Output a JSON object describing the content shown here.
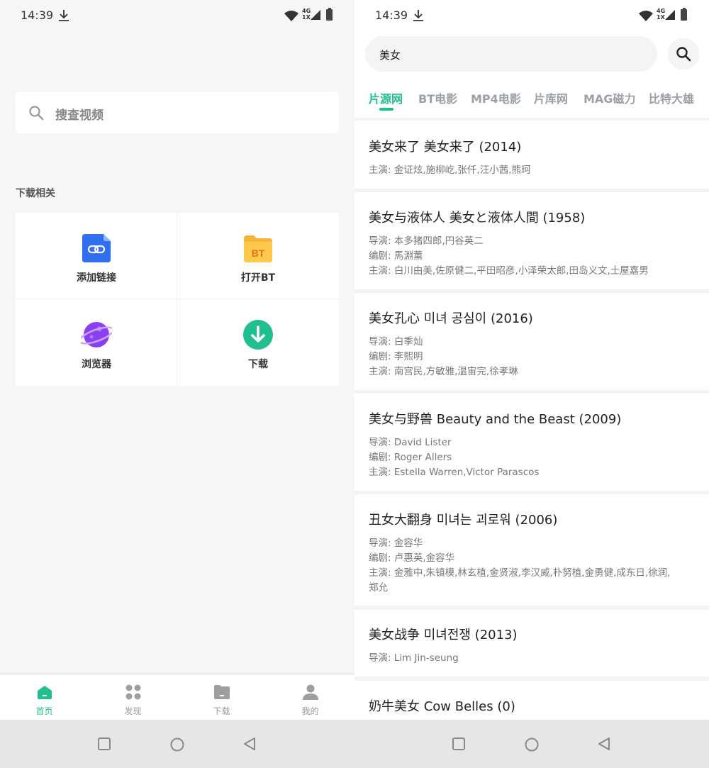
{
  "status": {
    "time": "14:39",
    "network": "4G",
    "network_sub": "1X"
  },
  "home": {
    "search_placeholder": "搜查视频",
    "section_title": "下载相关",
    "tools": [
      {
        "label": "添加链接",
        "icon": "link-icon"
      },
      {
        "label": "打开BT",
        "icon": "bt-folder-icon",
        "icon_text": "BT"
      },
      {
        "label": "浏览器",
        "icon": "planet-icon"
      },
      {
        "label": "下载",
        "icon": "download-icon"
      }
    ],
    "nav": [
      {
        "label": "首页",
        "icon": "home-icon",
        "active": true
      },
      {
        "label": "发现",
        "icon": "discover-icon",
        "active": false
      },
      {
        "label": "下载",
        "icon": "folder-icon",
        "active": false
      },
      {
        "label": "我的",
        "icon": "user-icon",
        "active": false
      }
    ]
  },
  "search": {
    "query": "美女",
    "tabs": [
      "片源网",
      "BT电影",
      "MP4电影",
      "片库网",
      "MAG磁力",
      "比特大雄"
    ],
    "active_tab": 0,
    "results": [
      {
        "title": "美女来了 美女来了 (2014)",
        "lines": [
          "主演: 金证炫,施柳屹,张仟,汪小茜,熊珂"
        ]
      },
      {
        "title": "美女与液体人 美女と液体人間 (1958)",
        "lines": [
          "导演: 本多猪四郎,円谷英二",
          "编剧: 馬淵薫",
          "主演: 白川由美,佐原健二,平田昭彦,小泽荣太郎,田岛义文,土屋嘉男"
        ]
      },
      {
        "title": "美女孔心 미녀 공심이 (2016)",
        "lines": [
          "导演: 白季灿",
          "编剧: 李熙明",
          "主演: 南宫民,方敏雅,温宙完,徐孝琳"
        ]
      },
      {
        "title": "美女与野兽 Beauty and the Beast (2009)",
        "lines": [
          "导演: David Lister",
          "编剧: Roger Allers",
          "主演: Estella Warren,Victor Parascos"
        ]
      },
      {
        "title": "丑女大翻身 미녀는 괴로워 (2006)",
        "lines": [
          "导演: 金容华",
          "编剧: 卢惠英,金容华",
          "主演: 金雅中,朱镇模,林玄植,金贤淑,李汉威,朴努植,金勇健,成东日,徐润,",
          "郑允"
        ]
      },
      {
        "title": "美女战争 미녀전쟁 (2013)",
        "lines": [
          "导演: Lim Jin-seung"
        ]
      },
      {
        "title": "奶牛美女 Cow Belles (0)",
        "lines": []
      }
    ]
  },
  "colors": {
    "accent": "#1fbf8f",
    "link_blue": "#2f6ff0",
    "bt_orange": "#f6b43a",
    "planet_purple": "#8a3ff0"
  }
}
